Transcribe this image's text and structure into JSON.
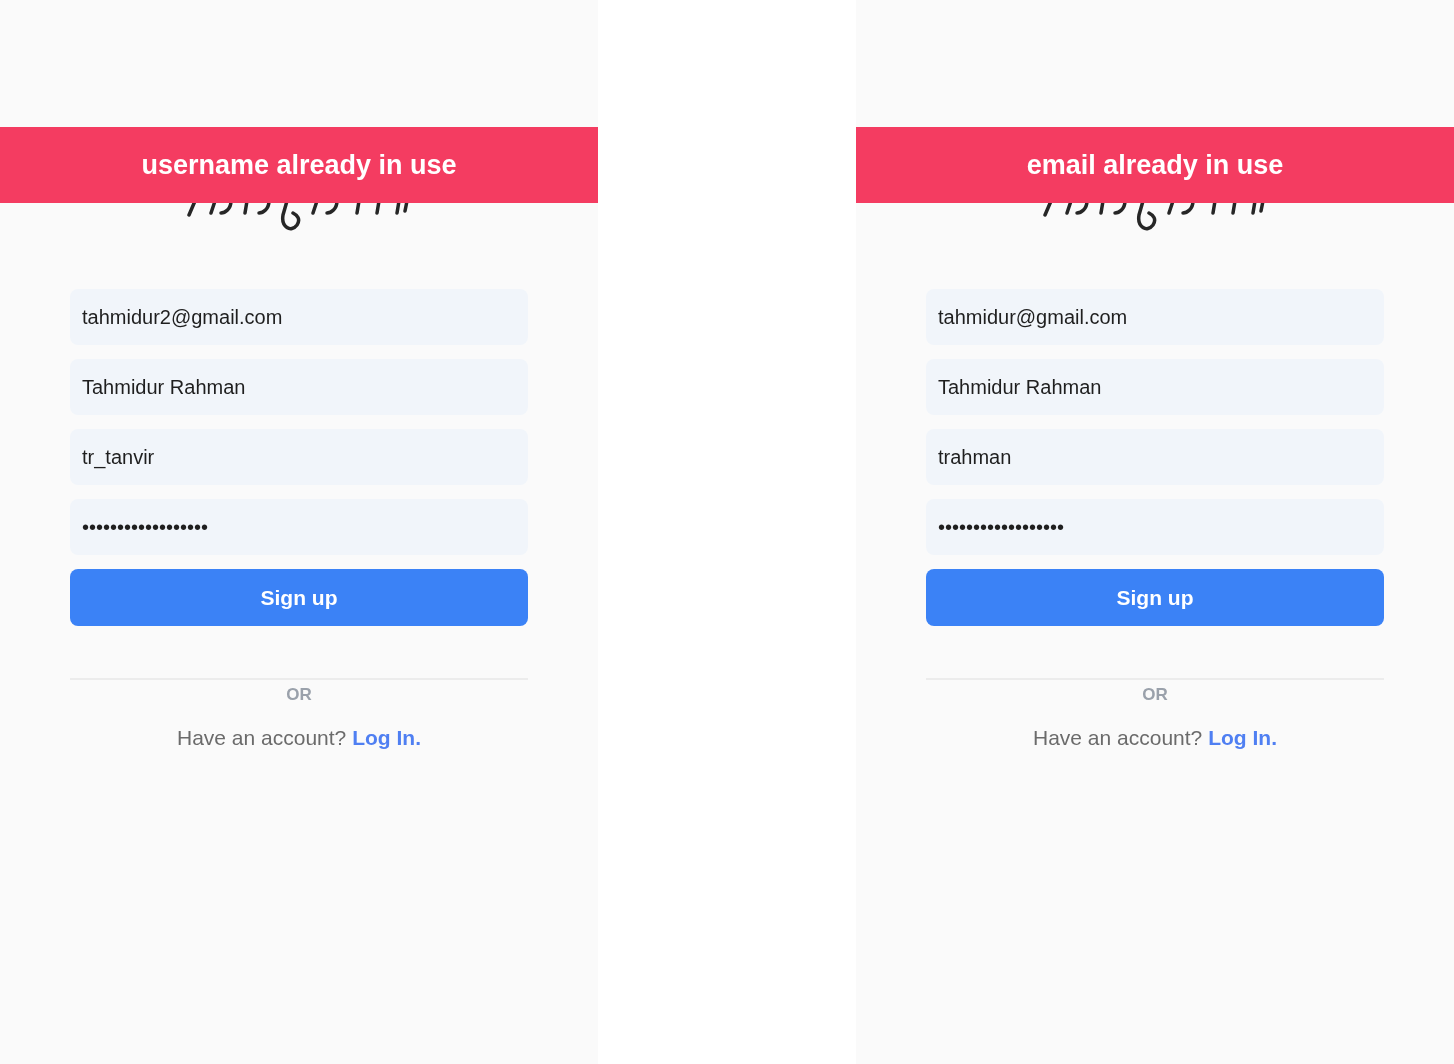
{
  "screens": [
    {
      "banner": "username already in use",
      "fields": [
        "tahmidur2@gmail.com",
        "Tahmidur Rahman",
        "tr_tanvir",
        "••••••••••••••••••"
      ],
      "button": "Sign up",
      "divider": "OR",
      "prompt": "Have an account?",
      "link": "Log In."
    },
    {
      "banner": "email already in use",
      "fields": [
        "tahmidur@gmail.com",
        "Tahmidur Rahman",
        "trahman",
        "••••••••••••••••••"
      ],
      "button": "Sign up",
      "divider": "OR",
      "prompt": "Have an account?",
      "link": "Log In."
    }
  ]
}
